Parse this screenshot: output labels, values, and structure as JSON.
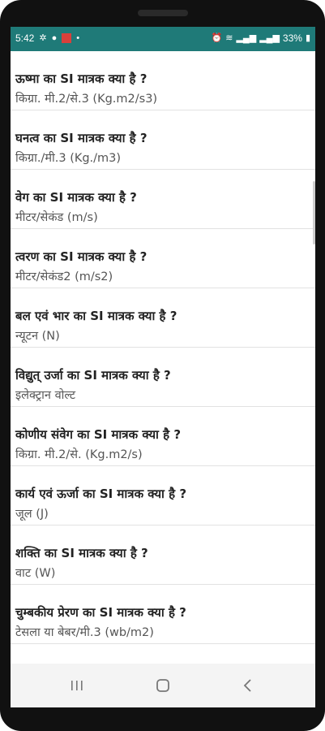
{
  "status_bar": {
    "time": "5:42",
    "battery": "33%"
  },
  "items": [
    {
      "question": "ऊष्मा का SI मात्रक क्या है ?",
      "answer": "किग्रा. मी.2/से.3 (Kg.m2/s3)"
    },
    {
      "question": "घनत्व का SI मात्रक क्या है ?",
      "answer": "किग्रा./मी.3 (Kg./m3)"
    },
    {
      "question": "वेग का SI मात्रक क्या है ?",
      "answer": "मीटर/सेकंड (m/s)"
    },
    {
      "question": "त्वरण का SI मात्रक क्या है ?",
      "answer": "मीटर/सेकंड2 (m/s2)"
    },
    {
      "question": "बल एवं भार का SI मात्रक क्या है ?",
      "answer": "न्यूटन (N)"
    },
    {
      "question": "विद्युत् उर्जा का SI मात्रक क्या है ?",
      "answer": "इलेक्ट्रान वोल्ट"
    },
    {
      "question": "कोणीय संवेग का SI मात्रक क्या है ?",
      "answer": "किग्रा. मी.2/से. (Kg.m2/s)"
    },
    {
      "question": "कार्य एवं ऊर्जा का SI मात्रक क्या है ?",
      "answer": "जूल (J)"
    },
    {
      "question": "शक्ति का SI मात्रक क्या है ?",
      "answer": "वाट (W)"
    },
    {
      "question": "चुम्बकीय प्रेरण का SI मात्रक क्या है ?",
      "answer": "टेसला या बेबर/मी.3 (wb/m2)"
    }
  ],
  "icons": {
    "recents": "recents-icon",
    "home": "home-icon",
    "back": "back-icon"
  }
}
